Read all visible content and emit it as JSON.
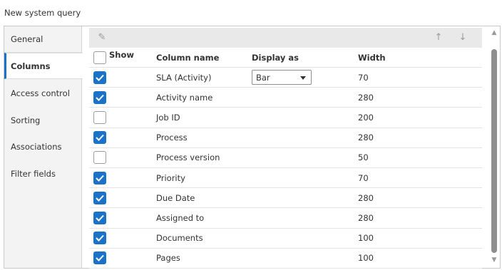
{
  "window": {
    "title": "New system query"
  },
  "nav": {
    "items": [
      {
        "label": "General"
      },
      {
        "label": "Columns"
      },
      {
        "label": "Access control"
      },
      {
        "label": "Sorting"
      },
      {
        "label": "Associations"
      },
      {
        "label": "Filter fields"
      }
    ],
    "active": "Columns"
  },
  "toolbar": {
    "edit_icon": "pencil-icon",
    "up_icon": "arrow-up-icon",
    "down_icon": "arrow-down-icon"
  },
  "grid": {
    "headers": {
      "show": "Show",
      "name": "Column name",
      "display": "Display as",
      "width": "Width"
    },
    "header_checked": false,
    "rows": [
      {
        "checked": true,
        "name": "SLA (Activity)",
        "display": "Bar",
        "width": "70"
      },
      {
        "checked": true,
        "name": "Activity name",
        "display": "",
        "width": "280"
      },
      {
        "checked": false,
        "name": "Job ID",
        "display": "",
        "width": "200"
      },
      {
        "checked": true,
        "name": "Process",
        "display": "",
        "width": "280"
      },
      {
        "checked": false,
        "name": "Process version",
        "display": "",
        "width": "50"
      },
      {
        "checked": true,
        "name": "Priority",
        "display": "",
        "width": "70"
      },
      {
        "checked": true,
        "name": "Due Date",
        "display": "",
        "width": "280"
      },
      {
        "checked": true,
        "name": "Assigned to",
        "display": "",
        "width": "280"
      },
      {
        "checked": true,
        "name": "Documents",
        "display": "",
        "width": "100"
      },
      {
        "checked": true,
        "name": "Pages",
        "display": "",
        "width": "100"
      }
    ]
  },
  "colors": {
    "accent": "#1a73c9",
    "toolbar_bg": "#e9e9e9",
    "nav_bg": "#f3f3f3"
  }
}
